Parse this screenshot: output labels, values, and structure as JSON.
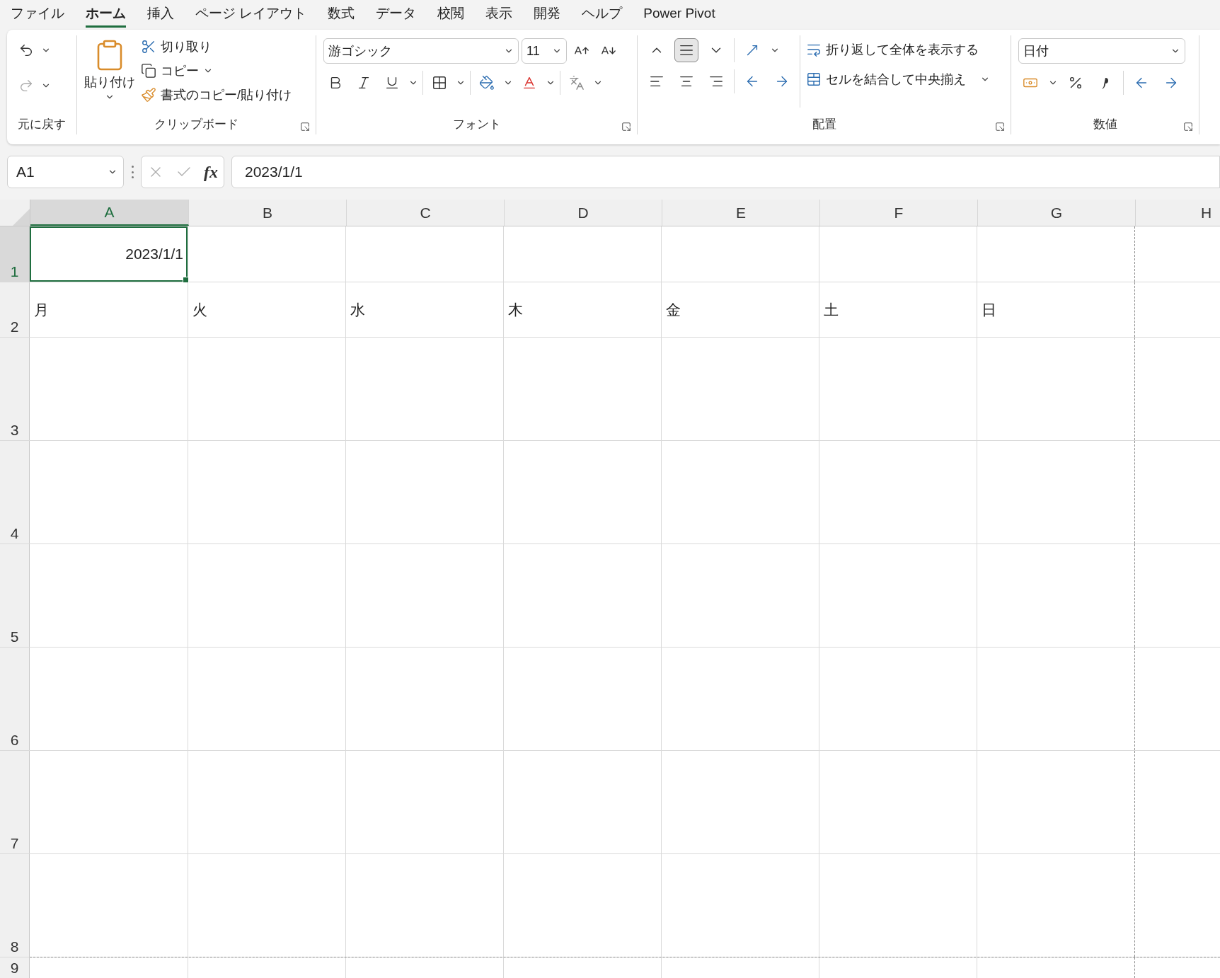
{
  "menu_tabs": [
    {
      "label": "ファイル",
      "selected": false
    },
    {
      "label": "ホーム",
      "selected": true
    },
    {
      "label": "挿入",
      "selected": false
    },
    {
      "label": "ページ レイアウト",
      "selected": false
    },
    {
      "label": "数式",
      "selected": false
    },
    {
      "label": "データ",
      "selected": false
    },
    {
      "label": "校閲",
      "selected": false
    },
    {
      "label": "表示",
      "selected": false
    },
    {
      "label": "開発",
      "selected": false
    },
    {
      "label": "ヘルプ",
      "selected": false
    },
    {
      "label": "Power Pivot",
      "selected": false
    }
  ],
  "ribbon": {
    "undo": {
      "label": "元に戻す"
    },
    "clipboard": {
      "paste": "貼り付け",
      "cut": "切り取り",
      "copy": "コピー",
      "format_painter": "書式のコピー/貼り付け",
      "label": "クリップボード"
    },
    "font": {
      "font_name": "游ゴシック",
      "font_size": "11",
      "label": "フォント"
    },
    "alignment": {
      "vertical": [
        {
          "selected": false
        },
        {
          "selected": true
        },
        {
          "selected": false
        }
      ],
      "wrap_text": "折り返して全体を表示する",
      "merge_center": "セルを結合して中央揃え",
      "label": "配置"
    },
    "number": {
      "format": "日付",
      "label": "数値"
    }
  },
  "formula_bar": {
    "name_box": "A1",
    "fx": "fx",
    "value": "2023/1/1"
  },
  "sheet": {
    "columns": [
      {
        "label": "A",
        "selected": true
      },
      {
        "label": "B",
        "selected": false
      },
      {
        "label": "C",
        "selected": false
      },
      {
        "label": "D",
        "selected": false
      },
      {
        "label": "E",
        "selected": false
      },
      {
        "label": "F",
        "selected": false
      },
      {
        "label": "G",
        "selected": false
      },
      {
        "label": "H",
        "selected": false
      }
    ],
    "rows": [
      {
        "header": "1",
        "selected": true,
        "cells": [
          {
            "text": "2023/1/1",
            "kind": "date",
            "selected": true
          }
        ]
      },
      {
        "header": "2",
        "selected": false,
        "cells": [
          {
            "text": "月",
            "kind": "text",
            "selected": false
          },
          {
            "text": "火",
            "kind": "text",
            "selected": false
          },
          {
            "text": "水",
            "kind": "text",
            "selected": false
          },
          {
            "text": "木",
            "kind": "text",
            "selected": false
          },
          {
            "text": "金",
            "kind": "text",
            "selected": false
          },
          {
            "text": "土",
            "kind": "text",
            "selected": false
          },
          {
            "text": "日",
            "kind": "text",
            "selected": false
          }
        ]
      },
      {
        "header": "3",
        "selected": false,
        "cells": []
      },
      {
        "header": "4",
        "selected": false,
        "cells": []
      },
      {
        "header": "5",
        "selected": false,
        "cells": []
      },
      {
        "header": "6",
        "selected": false,
        "cells": []
      },
      {
        "header": "7",
        "selected": false,
        "cells": []
      },
      {
        "header": "8",
        "selected": false,
        "cells": []
      },
      {
        "header": "9",
        "selected": false,
        "cells": []
      }
    ]
  }
}
